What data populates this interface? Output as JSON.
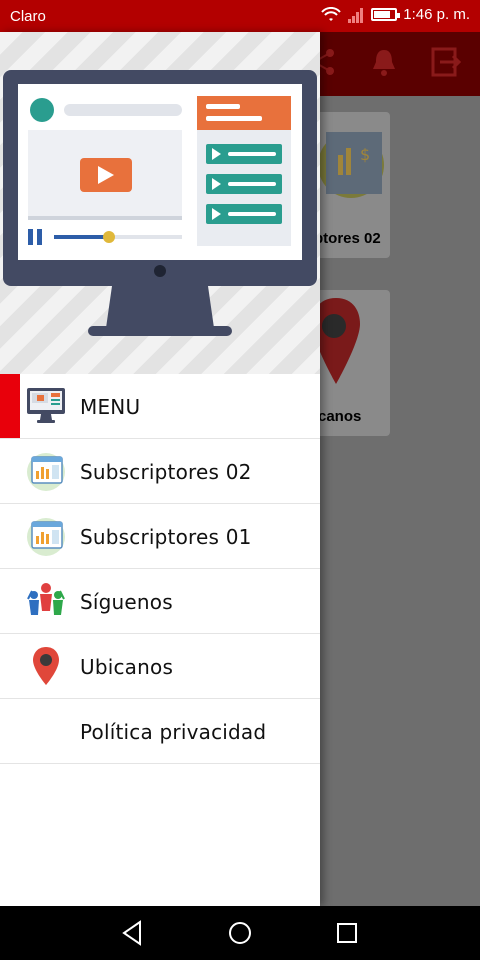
{
  "status_bar": {
    "carrier": "Claro",
    "time": "1:46 p. m.",
    "battery_level": 0.8
  },
  "app_bar": {
    "icons": [
      "share-icon",
      "bell-icon",
      "logout-icon"
    ]
  },
  "background": {
    "cards": [
      {
        "label": "Subscriptores 02",
        "visible_text": "ptores 02"
      },
      {
        "label": "Ubicanos",
        "visible_text": "canos"
      }
    ]
  },
  "drawer": {
    "menu": [
      {
        "label": "MENU",
        "icon": "monitor-icon",
        "active": true
      },
      {
        "label": "Subscriptores 02",
        "icon": "dashboard-icon"
      },
      {
        "label": "Subscriptores 01",
        "icon": "dashboard-icon"
      },
      {
        "label": "Síguenos",
        "icon": "people-icon"
      },
      {
        "label": "Ubicanos",
        "icon": "location-pin-icon"
      },
      {
        "label": "Política privacidad",
        "icon": ""
      }
    ]
  },
  "nav_bar": {
    "buttons": [
      "back-icon",
      "home-icon",
      "recents-icon"
    ]
  },
  "colors": {
    "status_bar": "#b30000",
    "accent": "#e8000b",
    "drawer_bg": "#ffffff",
    "scrim": "#6e6e6e"
  }
}
